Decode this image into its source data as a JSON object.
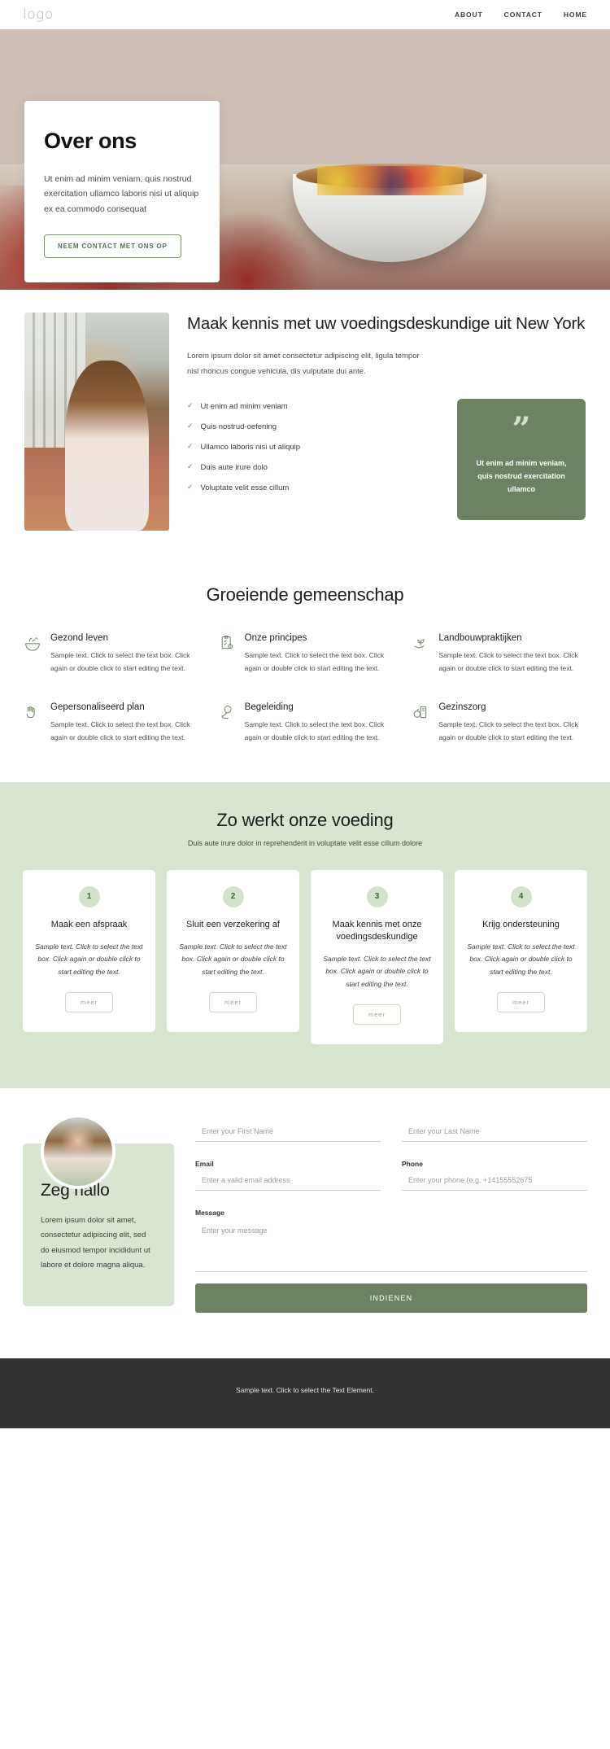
{
  "header": {
    "logo": "logo",
    "nav": [
      {
        "label": "ABOUT"
      },
      {
        "label": "CONTACT"
      },
      {
        "label": "HOME"
      }
    ]
  },
  "hero": {
    "title": "Over ons",
    "body": "Ut enim ad minim veniam, quis nostrud exercitation ullamco laboris nisi ut aliquip ex ea commodo consequat",
    "cta": "NEEM CONTACT MET ONS OP"
  },
  "expert": {
    "heading": "Maak kennis met uw voedingsdeskundige uit New York",
    "lead": "Lorem ipsum dolor sit amet consectetur adipiscing elit, ligula tempor nisl rhoncus congue vehicula, dis vulputate dui ante.",
    "checklist": [
      "Ut enim ad minim veniam",
      "Quis nostrud-oefening",
      "Ullamco laboris nisi ut aliquip",
      "Duis aute irure dolo",
      "Voluptate velit esse cillum"
    ],
    "quote_mark": "”",
    "quote": "Ut enim ad minim veniam, quis nostrud exercitation ullamco"
  },
  "community": {
    "heading": "Groeiende gemeenschap",
    "sample_text": "Sample text. Click to select the text box. Click again or double click to start editing the text.",
    "features": [
      {
        "icon": "salad-bowl-icon",
        "title": "Gezond leven",
        "text": "Sample text. Click to select the text box. Click again or double click to start editing the text."
      },
      {
        "icon": "clipboard-check-icon",
        "title": "Onze principes",
        "text": "Sample text. Click to select the text box. Click again or double click to start editing the text."
      },
      {
        "icon": "sprout-hand-icon",
        "title": "Landbouwpraktijken",
        "text": "Sample text. Click to select the text box. Click again or double click to start editing the text."
      },
      {
        "icon": "hand-heart-icon",
        "title": "Gepersonaliseerd plan",
        "text": "Sample text. Click to select the text box. Click again or double click to start editing the text."
      },
      {
        "icon": "hand-leaf-icon",
        "title": "Begeleiding",
        "text": "Sample text. Click to select the text box. Click again or double click to start editing the text."
      },
      {
        "icon": "apple-chart-icon",
        "title": "Gezinszorg",
        "text": "Sample text. Click to select the text box. Click again or double click to start editing the text."
      }
    ]
  },
  "steps_section": {
    "heading": "Zo werkt onze voeding",
    "subheading": "Duis aute irure dolor in reprehenderit in voluptate velit esse cillum dolore",
    "steps": [
      {
        "num": "1",
        "title": "Maak een afspraak",
        "text": "Sample text. Click to select the text box. Click again or double click to start editing the text.",
        "button": "meer"
      },
      {
        "num": "2",
        "title": "Sluit een verzekering af",
        "text": "Sample text. Click to select the text box. Click again or double click to start editing the text.",
        "button": "meer"
      },
      {
        "num": "3",
        "title": "Maak kennis met onze voedingsdeskundige",
        "text": "Sample text. Click to select the text box. Click again or double click to start editing the text.",
        "button": "meer"
      },
      {
        "num": "4",
        "title": "Krijg ondersteuning",
        "text": "Sample text. Click to select the text box. Click again or double click to start editing the text.",
        "button": "meer"
      }
    ]
  },
  "contact": {
    "heading": "Zeg hallo",
    "body": "Lorem ipsum dolor sit amet, consectetur adipiscing elit, sed do eiusmod tempor incididunt ut labore et dolore magna aliqua.",
    "form": {
      "first_name": {
        "label": "",
        "placeholder": "Enter your First Name",
        "value": ""
      },
      "last_name": {
        "label": "",
        "placeholder": "Enter your Last Name",
        "value": ""
      },
      "email": {
        "label": "Email",
        "placeholder": "Enter a valid email address",
        "value": ""
      },
      "phone": {
        "label": "Phone",
        "placeholder": "Enter your phone (e.g. +14155552675",
        "value": ""
      },
      "message": {
        "label": "Message",
        "placeholder": "Enter your message",
        "value": ""
      },
      "submit": "INDIENEN"
    }
  },
  "footer": {
    "text": "Sample text. Click to select the Text Element."
  },
  "colors": {
    "accent_green": "#6d8263",
    "light_green": "#d8e5d0",
    "footer_dark": "#333333"
  }
}
